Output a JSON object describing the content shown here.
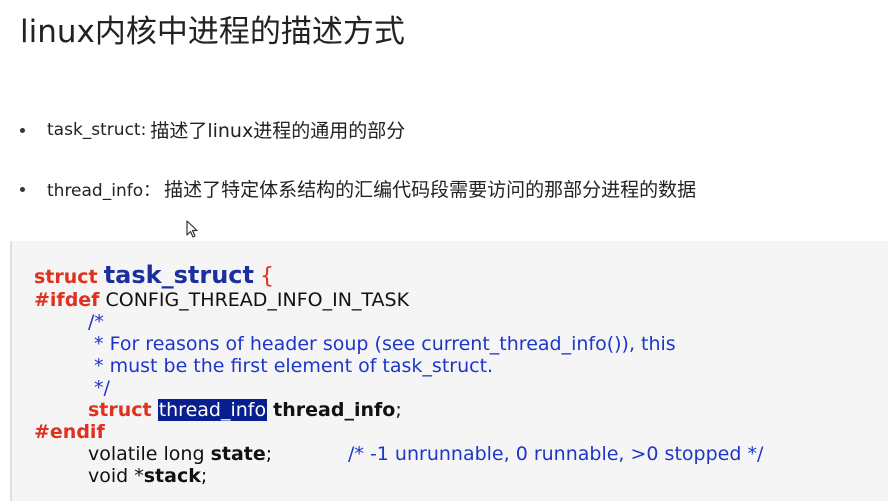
{
  "slide": {
    "title": "linux内核中进程的描述方式",
    "bullets": [
      {
        "term": "task_struct:",
        "text": " 描述了linux进程的通用的部分"
      },
      {
        "term": "thread_info：",
        "text": "描述了特定体系结构的汇编代码段需要访问的那部分进程的数据"
      }
    ]
  },
  "code": {
    "line1_kw": "struct",
    "line1_name": "task_struct",
    "line1_brace": "{",
    "line2_kw": "#ifdef",
    "line2_rest": " CONFIG_THREAD_INFO_IN_TASK",
    "line3": "/*",
    "line4": " * For reasons of header soup (see current_thread_info()), this",
    "line5": " * must be the first element of task_struct.",
    "line6": " */",
    "line7_kw": "struct",
    "line7_type": "thread_info",
    "line7_field": "thread_info",
    "line7_semi": ";",
    "line8_kw": "#endif",
    "line9_type": "volatile long ",
    "line9_field": "state",
    "line9_semi": ";",
    "line9_comment": "/* -1 unrunnable, 0 runnable, >0 stopped */",
    "line10_type": "void *",
    "line10_field": "stack",
    "line10_semi": ";"
  },
  "icons": {
    "cursor": "mouse-pointer-icon"
  }
}
